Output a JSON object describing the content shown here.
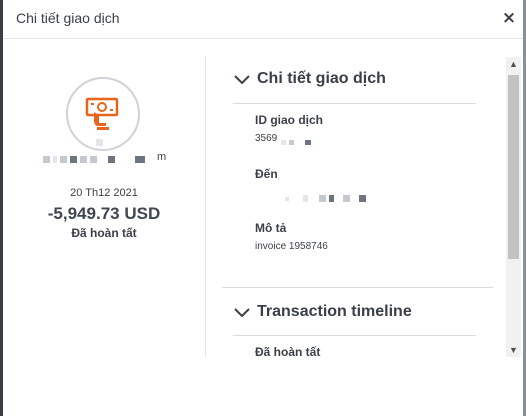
{
  "modal": {
    "title": "Chi tiết giao dịch",
    "close_symbol": "×"
  },
  "summary": {
    "icon": "cash-payment-icon",
    "accent_color": "#e8641b",
    "name_suffix": "m",
    "date": "20 Th12 2021",
    "amount": "-5,949.73 USD",
    "status": "Đã hoàn tất"
  },
  "details": {
    "heading": "Chi tiết giao dịch",
    "transaction_id_label": "ID giao dịch",
    "transaction_id_prefix": "3569",
    "to_label": "Đến",
    "description_label": "Mô tả",
    "description_value": "invoice 1958746"
  },
  "timeline": {
    "heading": "Transaction timeline",
    "first_status": "Đã hoàn tất"
  },
  "scrollbar": {
    "up_symbol": "▲",
    "down_symbol": "▼"
  }
}
